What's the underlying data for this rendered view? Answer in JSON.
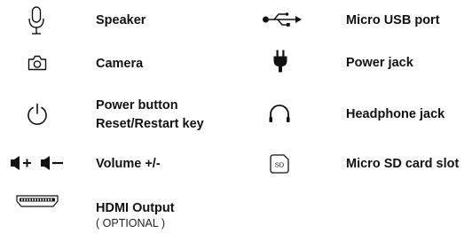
{
  "legend": {
    "left": [
      {
        "icon": "microphone-icon",
        "label": "Speaker"
      },
      {
        "icon": "camera-icon",
        "label": "Camera"
      },
      {
        "icon": "power-icon",
        "label": "Power button",
        "label2": "Reset/Restart key"
      },
      {
        "icon": "volume-icon",
        "label": "Volume +/-"
      },
      {
        "icon": "hdmi-port-icon",
        "label": "HDMI Output",
        "note": "( OPTIONAL )"
      }
    ],
    "right": [
      {
        "icon": "usb-icon",
        "label": "Micro USB port"
      },
      {
        "icon": "power-plug-icon",
        "label": "Power jack"
      },
      {
        "icon": "headphone-icon",
        "label": "Headphone jack"
      },
      {
        "icon": "sd-card-icon",
        "label": "Micro SD card slot",
        "icon_text": "SD"
      }
    ]
  }
}
